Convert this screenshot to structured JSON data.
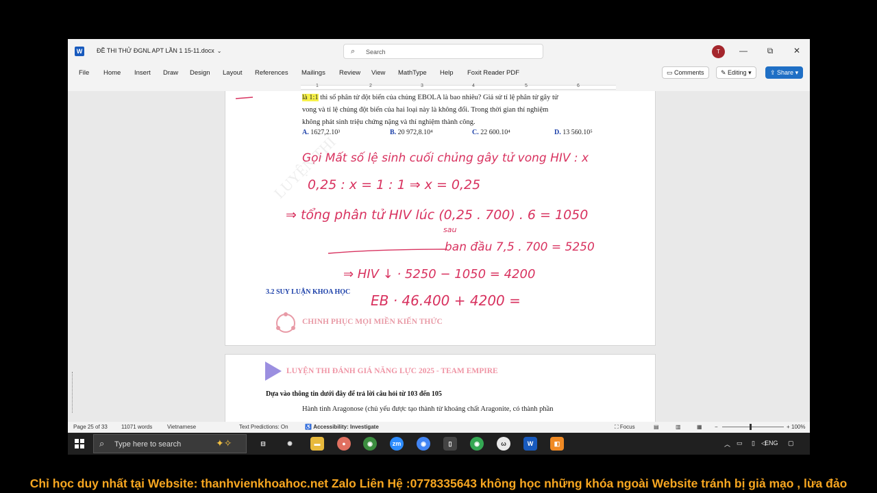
{
  "window": {
    "title": "ĐỀ THI THỬ ĐGNL APT LẦN 1 15-11.docx",
    "search_placeholder": "Search",
    "avatar_initial": "T",
    "controls": {
      "minimize": "—",
      "restore": "⧉",
      "close": "✕"
    }
  },
  "ribbon": {
    "tabs": [
      "File",
      "Home",
      "Insert",
      "Draw",
      "Design",
      "Layout",
      "References",
      "Mailings",
      "Review",
      "View",
      "MathType",
      "Help",
      "Foxit Reader PDF"
    ],
    "comments": "Comments",
    "editing": "Editing",
    "share": "Share"
  },
  "ruler": {
    "numbers": [
      "1",
      "1",
      "2",
      "3",
      "4",
      "5",
      "6"
    ]
  },
  "document": {
    "question_lines": [
      "thì số phân tử đột biến của chủng EBOLA là bao nhiêu? Giả sử tỉ lệ phân tử gây tử",
      "vong và tỉ lệ chủng đột biến của hai loại này là không đổi. Trong thời gian thí nghiệm",
      "không phát sinh triệu chứng nặng và thí nghiệm thành công."
    ],
    "highlight": "là 1:1",
    "answers": [
      {
        "key": "A.",
        "text": "1627,2.10³"
      },
      {
        "key": "B.",
        "text": "20 972,8.10⁴"
      },
      {
        "key": "C.",
        "text": "22 600.10⁴"
      },
      {
        "key": "D.",
        "text": "13 560.10⁵"
      }
    ],
    "watermark": "LUYỆN THI",
    "section_heading": "3.2 SUY LUẬN KHOA HỌC",
    "brand_line": "CHINH PHỤC MỌI MIỀN KIẾN THỨC",
    "handwriting": [
      "Gọi Mất số lệ sinh cuối chủng gây tử vong HIV : x",
      "0,25 : x = 1 : 1 ⇒ x = 0,25",
      "⇒ tổng phân tử HIV lúc (0,25 . 700) . 6 = 1050",
      "sau",
      "ban đầu 7,5 . 700 = 5250",
      "⇒ HIV ↓ · 5250 − 1050 = 4200",
      "EB · 46.400 + 4200 ="
    ],
    "page2_title": "LUYỆN THI ĐÁNH GIÁ NĂNG LỰC 2025 - TEAM EMPIRE",
    "page2_subheading": "Dựa vào thông tin dưới đây để trả lời câu hỏi từ 103 đến 105",
    "page2_body": "Hành tinh Aragonose (chủ yếu được tạo thành từ khoáng chất Aragonite, có thành phần"
  },
  "status": {
    "page": "Page 25 of 33",
    "words": "11071 words",
    "language": "Vietnamese",
    "predictions": "Text Predictions: On",
    "accessibility": "Accessibility: Investigate",
    "focus": "Focus",
    "zoom": "100%"
  },
  "taskbar": {
    "search_placeholder": "Type here to search",
    "lang": "ENG",
    "apps": [
      "task-view",
      "widgets",
      "file-explorer",
      "chat",
      "chrome",
      "zoom",
      "chrome",
      "phone",
      "chrome",
      "app-w",
      "word",
      "app-orange"
    ]
  },
  "banner": "Chỉ học duy nhất tại Website: thanhvienkhoahoc.net  Zalo Liên Hệ :0778335643 không học những khóa ngoài Website tránh bị giả mạo , lừa đảo"
}
